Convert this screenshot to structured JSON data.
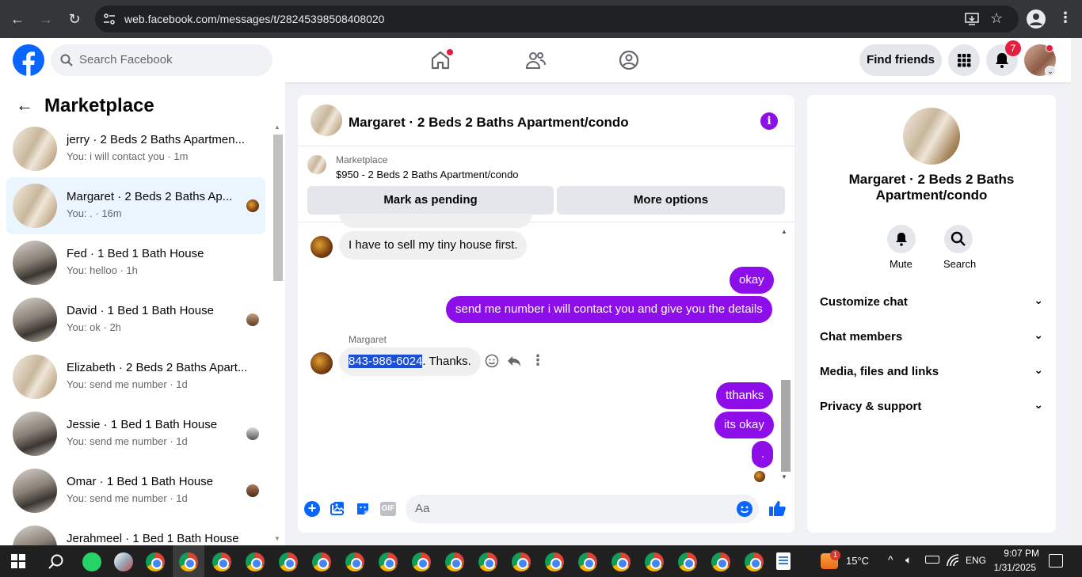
{
  "browser": {
    "url": "web.facebook.com/messages/t/28245398508408020"
  },
  "header": {
    "search_placeholder": "Search Facebook",
    "find_friends": "Find friends",
    "notification_count": "7"
  },
  "sidebar": {
    "title": "Marketplace",
    "conversations": [
      {
        "title": "jerry · 2 Beds 2 Baths Apartmen...",
        "preview": "You: i will contact you · 1m"
      },
      {
        "title": "Margaret · 2 Beds 2 Baths Ap...",
        "preview": "You: . · 16m"
      },
      {
        "title": "Fed · 1 Bed 1 Bath House",
        "preview": "You: helloo · 1h"
      },
      {
        "title": "David · 1 Bed 1 Bath House",
        "preview": "You: ok · 2h"
      },
      {
        "title": "Elizabeth · 2 Beds 2 Baths Apart...",
        "preview": "You: send me number · 1d"
      },
      {
        "title": "Jessie · 1 Bed 1 Bath House",
        "preview": "You: send me number · 1d"
      },
      {
        "title": "Omar · 1 Bed 1 Bath House",
        "preview": "You: send me number · 1d"
      },
      {
        "title": "Jerahmeel · 1 Bed 1 Bath House",
        "preview": ""
      }
    ]
  },
  "chat": {
    "title": "Margaret · 2 Beds 2 Baths Apartment/condo",
    "listing_label": "Marketplace",
    "listing_detail": "$950 - 2 Beds 2 Baths Apartment/condo",
    "mark_pending": "Mark as pending",
    "more_options": "More options",
    "messages": {
      "m1": "I have to sell my tiny house first.",
      "m2": "okay",
      "m3": "send me number i will contact you and give you the details",
      "sender": "Margaret",
      "m4_highlight": "843-986-6024",
      "m4_rest": ". Thanks.",
      "m5": "tthanks",
      "m6": "its okay",
      "m7": "."
    },
    "composer_placeholder": "Aa",
    "gif_label": "GIF"
  },
  "details": {
    "name": "Margaret · 2 Beds 2 Baths Apartment/condo",
    "mute": "Mute",
    "search": "Search",
    "sections": [
      "Customize chat",
      "Chat members",
      "Media, files and links",
      "Privacy & support"
    ]
  },
  "taskbar": {
    "temperature": "15°C",
    "language": "ENG",
    "time": "9:07 PM",
    "date": "1/31/2025",
    "weather_badge": "1"
  },
  "colors": {
    "accent": "#8d0ee8",
    "fb_blue": "#0866ff",
    "selected_bg": "#ebf5ff"
  }
}
